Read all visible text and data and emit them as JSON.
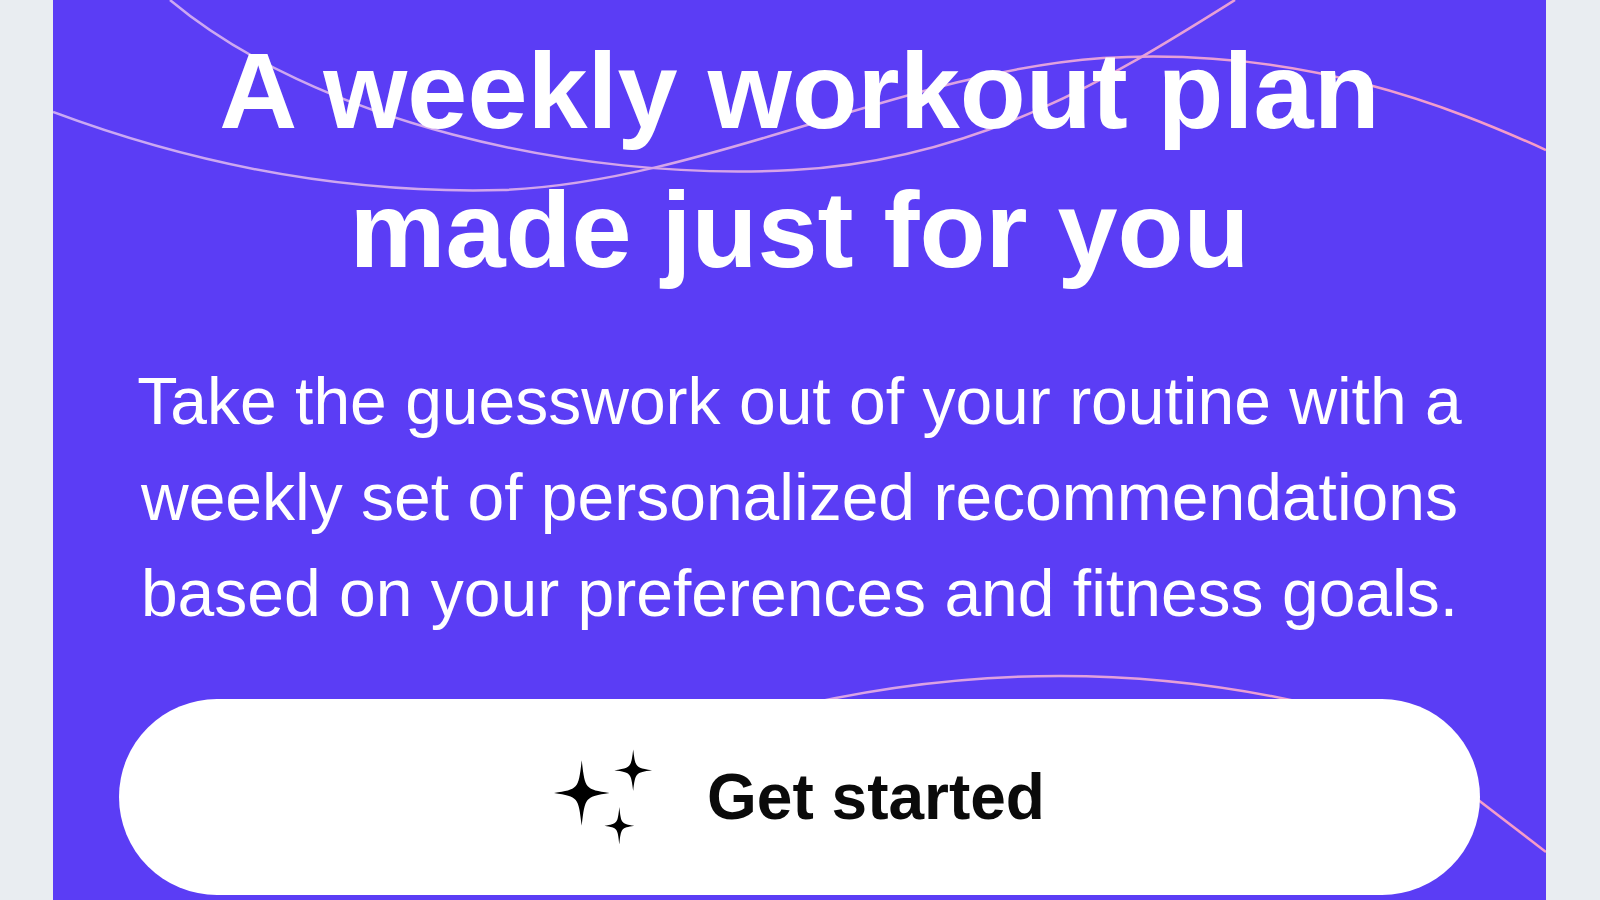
{
  "hero": {
    "title": "A weekly workout plan made just for you",
    "description": "Take the guesswork out of your routine with a weekly set of personalized recommendations based on your preferences and fitness goals.",
    "button": {
      "label": "Get started"
    }
  }
}
